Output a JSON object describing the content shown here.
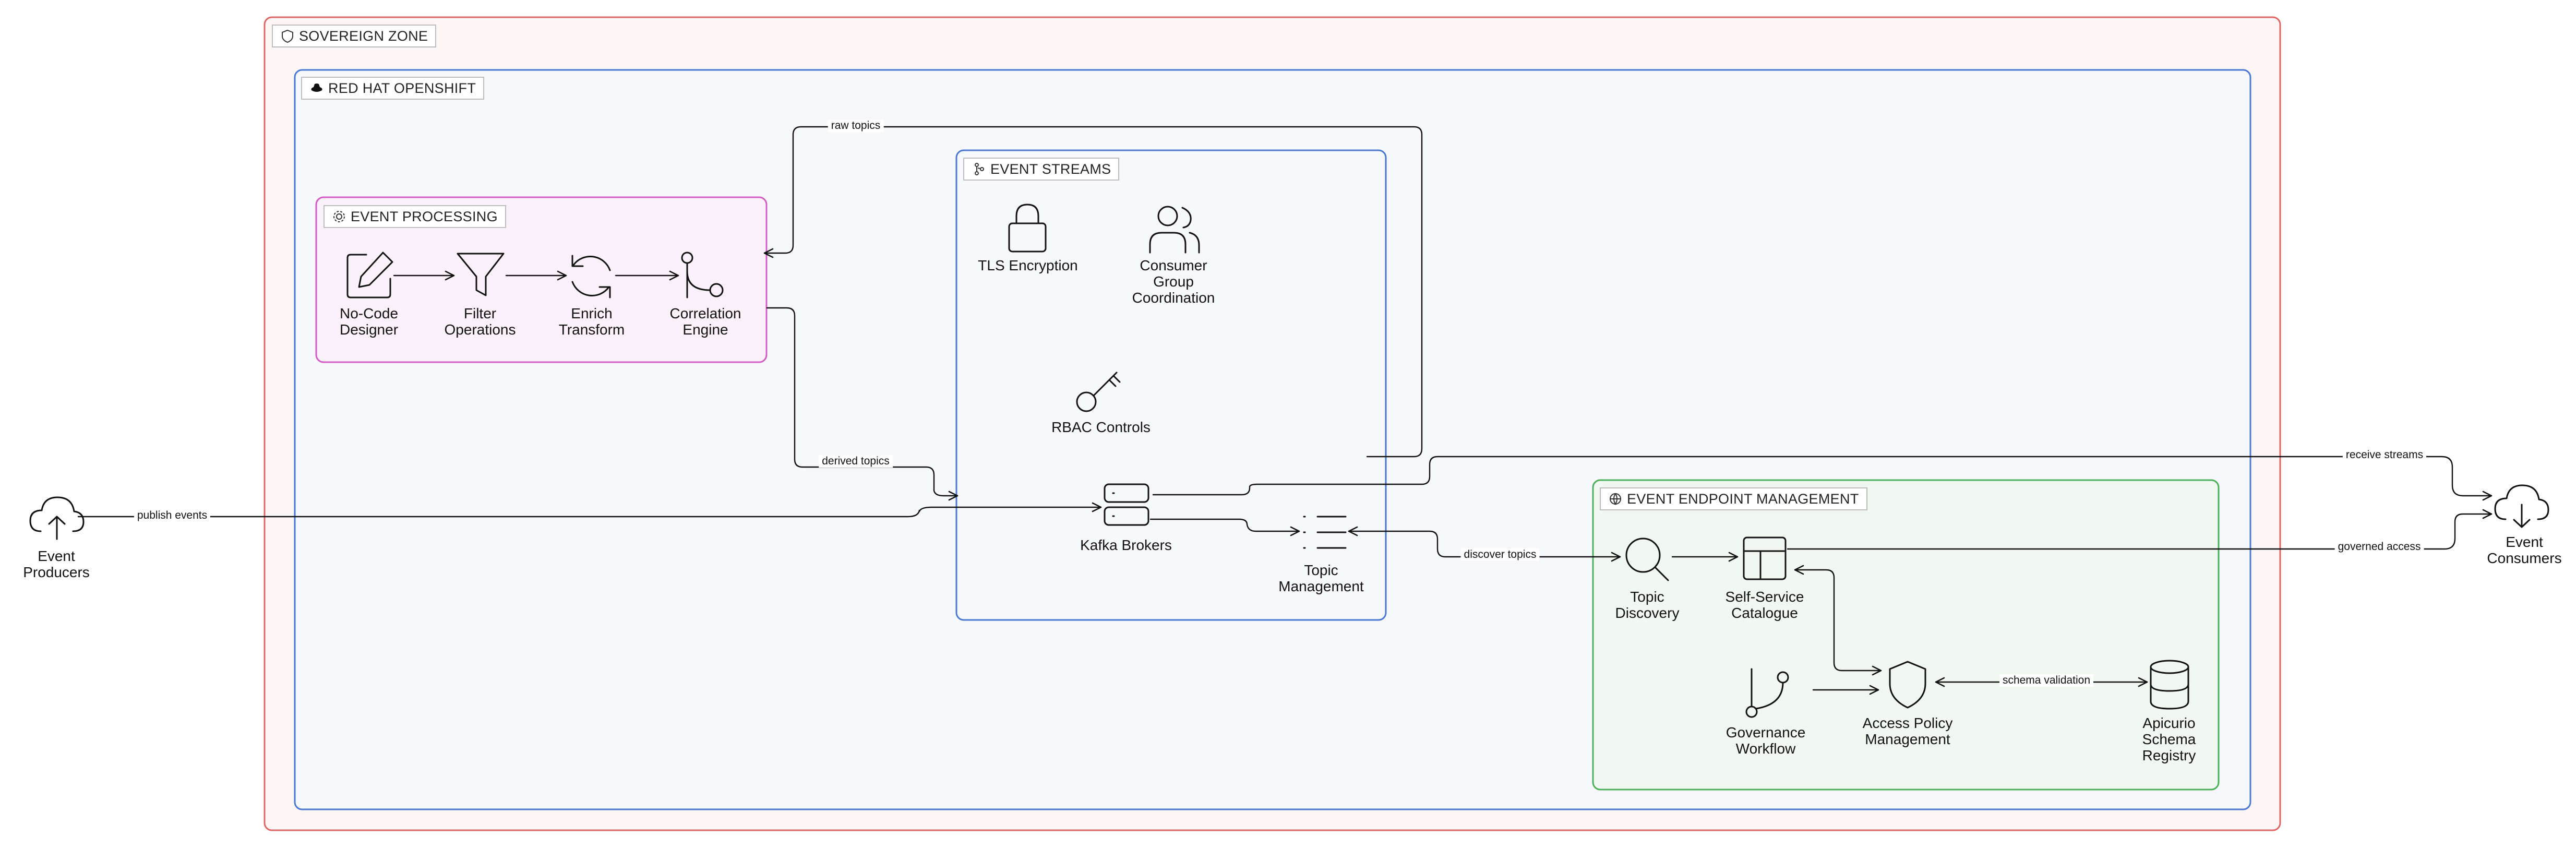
{
  "zones": {
    "sovereign": {
      "label": "SOVEREIGN ZONE",
      "icon": "shield-icon",
      "color": "#e06666"
    },
    "openshift": {
      "label": "RED HAT OPENSHIFT",
      "icon": "redhat-icon",
      "color": "#4a78d0"
    },
    "processing": {
      "label": "EVENT PROCESSING",
      "icon": "gear-icon",
      "color": "#d05cc4"
    },
    "streams": {
      "label": "EVENT STREAMS",
      "icon": "broker-icon",
      "color": "#4a78d0"
    },
    "endpoint": {
      "label": "EVENT ENDPOINT MANAGEMENT",
      "icon": "globe-icon",
      "color": "#4caf5a"
    }
  },
  "nodes": {
    "producers": {
      "label": "Event\nProducers",
      "icon": "cloud-upload-icon"
    },
    "consumers": {
      "label": "Event\nConsumers",
      "icon": "cloud-download-icon"
    },
    "designer": {
      "label": "No-Code\nDesigner",
      "icon": "edit-icon"
    },
    "filter": {
      "label": "Filter\nOperations",
      "icon": "filter-icon"
    },
    "enrich": {
      "label": "Enrich\nTransform",
      "icon": "refresh-icon"
    },
    "correlation": {
      "label": "Correlation\nEngine",
      "icon": "merge-icon"
    },
    "tls": {
      "label": "TLS Encryption",
      "icon": "lock-icon"
    },
    "consumer_group": {
      "label": "Consumer\nGroup\nCoordination",
      "icon": "users-icon"
    },
    "rbac": {
      "label": "RBAC Controls",
      "icon": "key-icon"
    },
    "brokers": {
      "label": "Kafka Brokers",
      "icon": "server-icon"
    },
    "topic_mgmt": {
      "label": "Topic\nManagement",
      "icon": "list-icon"
    },
    "topic_discovery": {
      "label": "Topic\nDiscovery",
      "icon": "search-icon"
    },
    "catalogue": {
      "label": "Self-Service\nCatalogue",
      "icon": "layout-icon"
    },
    "governance": {
      "label": "Governance\nWorkflow",
      "icon": "git-branch-icon"
    },
    "access_policy": {
      "label": "Access Policy\nManagement",
      "icon": "shield-icon"
    },
    "schema_registry": {
      "label": "Apicurio\nSchema\nRegistry",
      "icon": "database-icon"
    }
  },
  "edges": {
    "publish": "publish events",
    "raw_topics": "raw topics",
    "derived_topics": "derived topics",
    "receive_streams": "receive streams",
    "governed_access": "governed access",
    "discover_topics": "discover topics",
    "schema_validation": "schema validation"
  }
}
